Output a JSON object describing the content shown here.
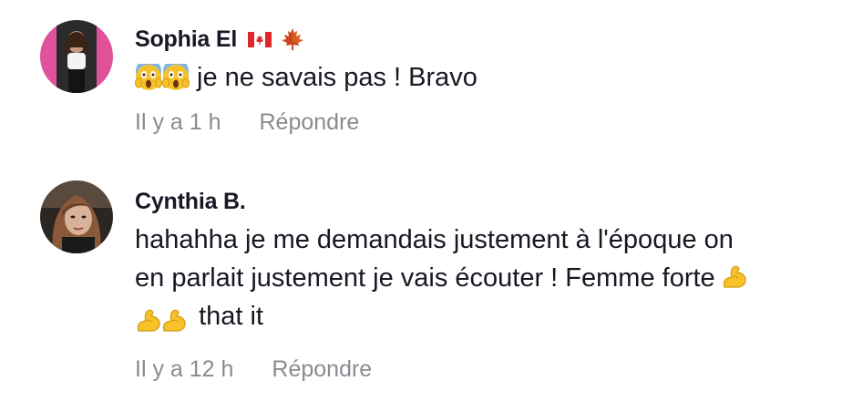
{
  "comments": [
    {
      "username": "Sophia El",
      "badges": [
        "canada-flag-icon",
        "maple-leaf-icon"
      ],
      "leading_emojis": [
        "face-screaming-in-fear-emoji",
        "face-screaming-in-fear-emoji"
      ],
      "text": "je ne savais pas ! Bravo",
      "time": "Il y a 1 h",
      "reply_label": "Répondre"
    },
    {
      "username": "Cynthia B.",
      "text_line1": "hahahha je me demandais justement à l'époque on",
      "text_line2": "en parlait justement je vais écouter ! Femme forte",
      "text_line3": "that it",
      "emojis": [
        "flexed-biceps-emoji",
        "flexed-biceps-emoji",
        "flexed-biceps-emoji"
      ],
      "time": "Il y a 12 h",
      "reply_label": "Répondre"
    }
  ],
  "colors": {
    "text": "#161823",
    "muted": "#8a8b91",
    "avatar1_bg": "#e0529a",
    "emoji_yellow": "#f7c229"
  }
}
